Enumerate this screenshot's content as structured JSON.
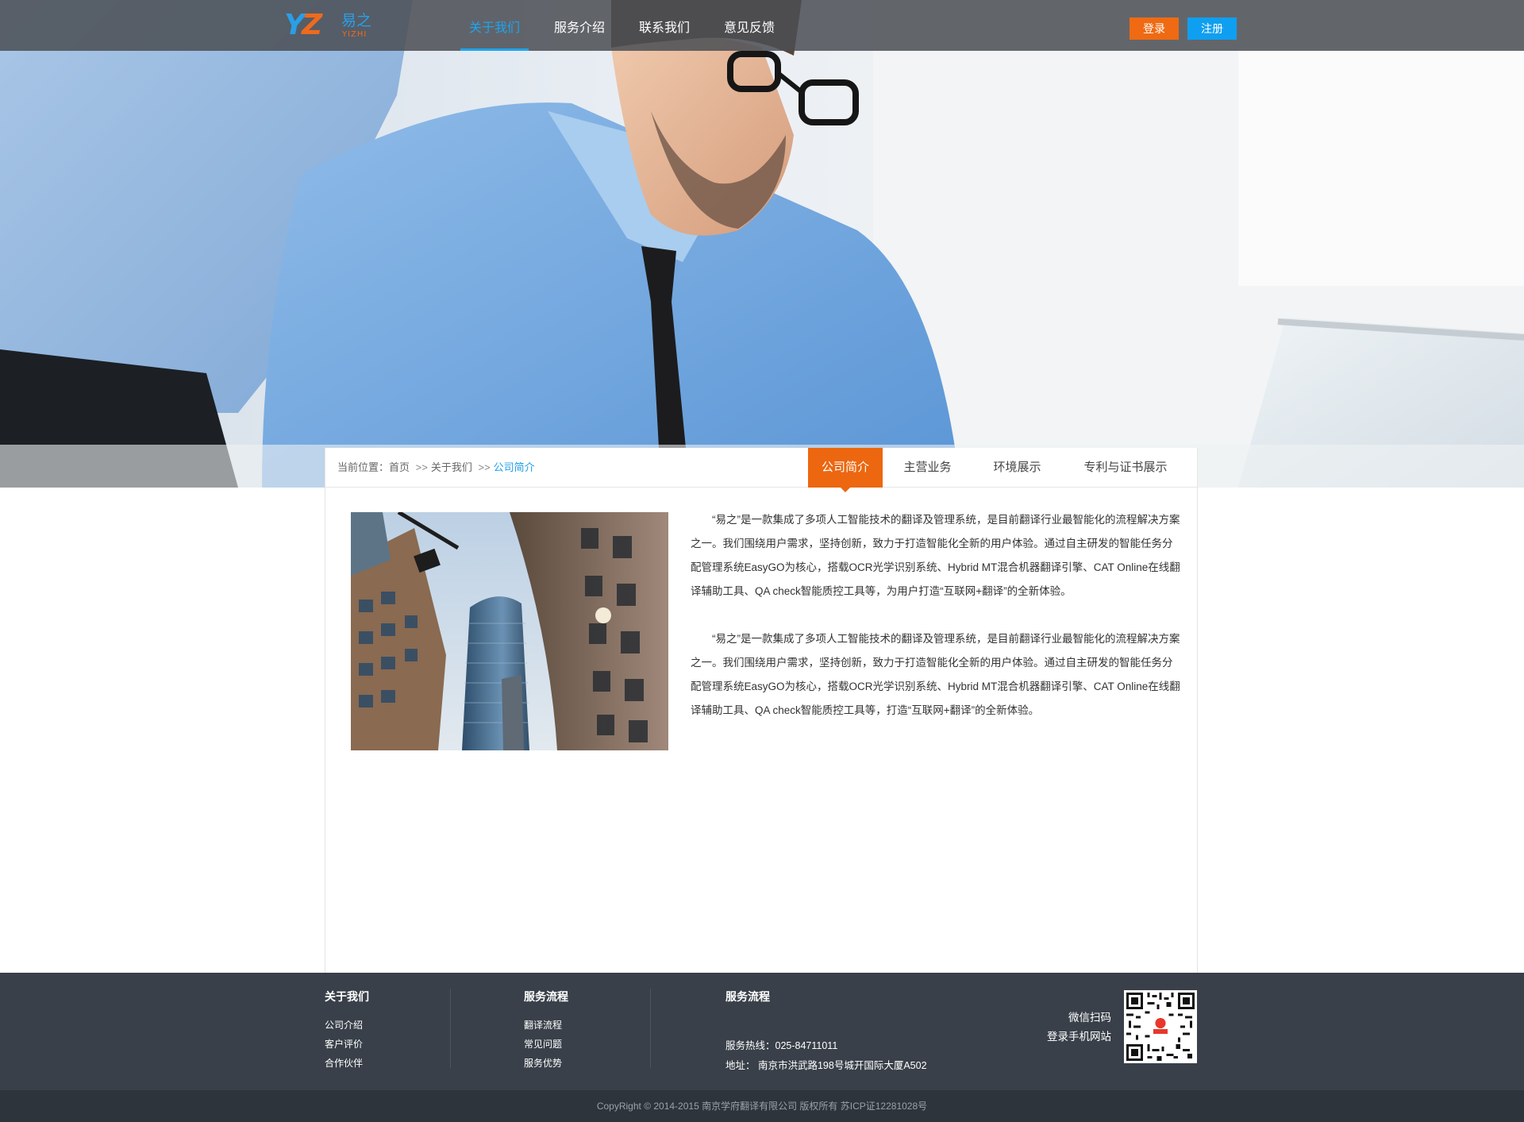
{
  "logo": {
    "mark": "YZ",
    "cn": "易之",
    "en": "YIZHI"
  },
  "nav": {
    "items": [
      {
        "label": "关于我们",
        "active": true
      },
      {
        "label": "服务介绍",
        "active": false
      },
      {
        "label": "联系我们",
        "active": false
      },
      {
        "label": "意见反馈",
        "active": false
      }
    ],
    "login": "登录",
    "register": "注册"
  },
  "breadcrumb": {
    "prefix": "当前位置：",
    "home": "首页",
    "sep": ">>",
    "level1": "关于我们",
    "current": "公司简介"
  },
  "subtabs": [
    {
      "label": "公司简介",
      "active": true
    },
    {
      "label": "主营业务",
      "active": false
    },
    {
      "label": "环境展示",
      "active": false
    },
    {
      "label": "专利与证书展示",
      "active": false
    }
  ],
  "article": {
    "p1": "“易之”是一款集成了多项人工智能技术的翻译及管理系统，是目前翻译行业最智能化的流程解决方案之一。我们围绕用户需求，坚持创新，致力于打造智能化全新的用户体验。通过自主研发的智能任务分配管理系统EasyGO为核心，搭载OCR光学识别系统、Hybrid MT混合机器翻译引擎、CAT Online在线翻译辅助工具、QA check智能质控工具等，为用户打造“互联网+翻译”的全新体验。",
    "p2": "“易之”是一款集成了多项人工智能技术的翻译及管理系统，是目前翻译行业最智能化的流程解决方案之一。我们围绕用户需求，坚持创新，致力于打造智能化全新的用户体验。通过自主研发的智能任务分配管理系统EasyGO为核心，搭载OCR光学识别系统、Hybrid MT混合机器翻译引擎、CAT Online在线翻译辅助工具、QA check智能质控工具等，打造“互联网+翻译”的全新体验。"
  },
  "footer": {
    "about": {
      "title": "关于我们",
      "links": [
        "公司介绍",
        "客户评价",
        "合作伙伴"
      ]
    },
    "process": {
      "title": "服务流程",
      "links": [
        "翻译流程",
        "常见问题",
        "服务优势"
      ]
    },
    "contact": {
      "title": "服务流程",
      "hotline": "服务热线：025-84711011",
      "address": "地址： 南京市洪武路198号城开国际大厦A502"
    },
    "wechat": {
      "line1": "微信扫码",
      "line2": "登录手机网站"
    }
  },
  "copyright": "CopyRight © 2014-2015 南京学府翻译有限公司 版权所有 苏ICP证12281028号",
  "colors": {
    "accent_blue": "#1ea4ee",
    "accent_orange": "#ec6710",
    "footer_bg": "#394049"
  }
}
